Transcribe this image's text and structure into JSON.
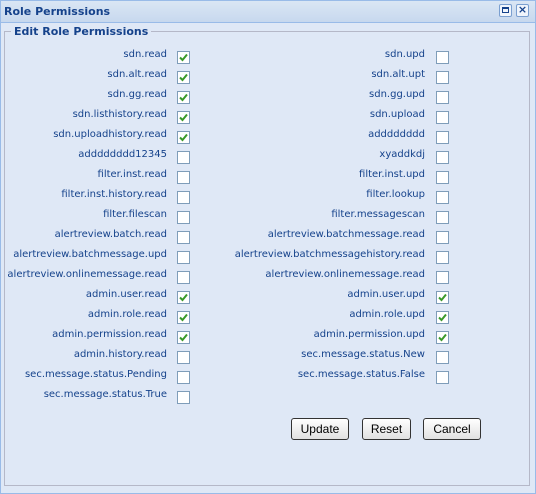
{
  "window": {
    "title": "Role Permissions"
  },
  "form": {
    "legend": "Edit Role Permissions"
  },
  "left_permissions": [
    {
      "label": "sdn.read",
      "checked": true
    },
    {
      "label": "sdn.alt.read",
      "checked": true
    },
    {
      "label": "sdn.gg.read",
      "checked": true
    },
    {
      "label": "sdn.listhistory.read",
      "checked": true
    },
    {
      "label": "sdn.uploadhistory.read",
      "checked": true
    },
    {
      "label": "adddddddd12345",
      "checked": false
    },
    {
      "label": "filter.inst.read",
      "checked": false
    },
    {
      "label": "filter.inst.history.read",
      "checked": false
    },
    {
      "label": "filter.filescan",
      "checked": false
    },
    {
      "label": "alertreview.batch.read",
      "checked": false
    },
    {
      "label": "alertreview.batchmessage.upd",
      "checked": false
    },
    {
      "label": "alertreview.onlinemessage.read",
      "checked": false
    },
    {
      "label": "admin.user.read",
      "checked": true
    },
    {
      "label": "admin.role.read",
      "checked": true
    },
    {
      "label": "admin.permission.read",
      "checked": true
    },
    {
      "label": "admin.history.read",
      "checked": false
    },
    {
      "label": "sec.message.status.Pending",
      "checked": false
    },
    {
      "label": "sec.message.status.True",
      "checked": false
    }
  ],
  "right_permissions": [
    {
      "label": "sdn.upd",
      "checked": false
    },
    {
      "label": "sdn.alt.upt",
      "checked": false
    },
    {
      "label": "sdn.gg.upd",
      "checked": false
    },
    {
      "label": "sdn.upload",
      "checked": false
    },
    {
      "label": "adddddddd",
      "checked": false
    },
    {
      "label": "xyaddkdj",
      "checked": false
    },
    {
      "label": "filter.inst.upd",
      "checked": false
    },
    {
      "label": "filter.lookup",
      "checked": false
    },
    {
      "label": "filter.messagescan",
      "checked": false
    },
    {
      "label": "alertreview.batchmessage.read",
      "checked": false
    },
    {
      "label": "alertreview.batchmessagehistory.read",
      "checked": false
    },
    {
      "label": "alertreview.onlinemessage.read",
      "checked": false
    },
    {
      "label": "admin.user.upd",
      "checked": true
    },
    {
      "label": "admin.role.upd",
      "checked": true
    },
    {
      "label": "admin.permission.upd",
      "checked": true
    },
    {
      "label": "sec.message.status.New",
      "checked": false
    },
    {
      "label": "sec.message.status.False",
      "checked": false
    }
  ],
  "buttons": {
    "update": "Update",
    "reset": "Reset",
    "cancel": "Cancel"
  },
  "colors": {
    "check": "#3a9a2a",
    "title": "#15428b",
    "panel": "#dfe8f6"
  }
}
